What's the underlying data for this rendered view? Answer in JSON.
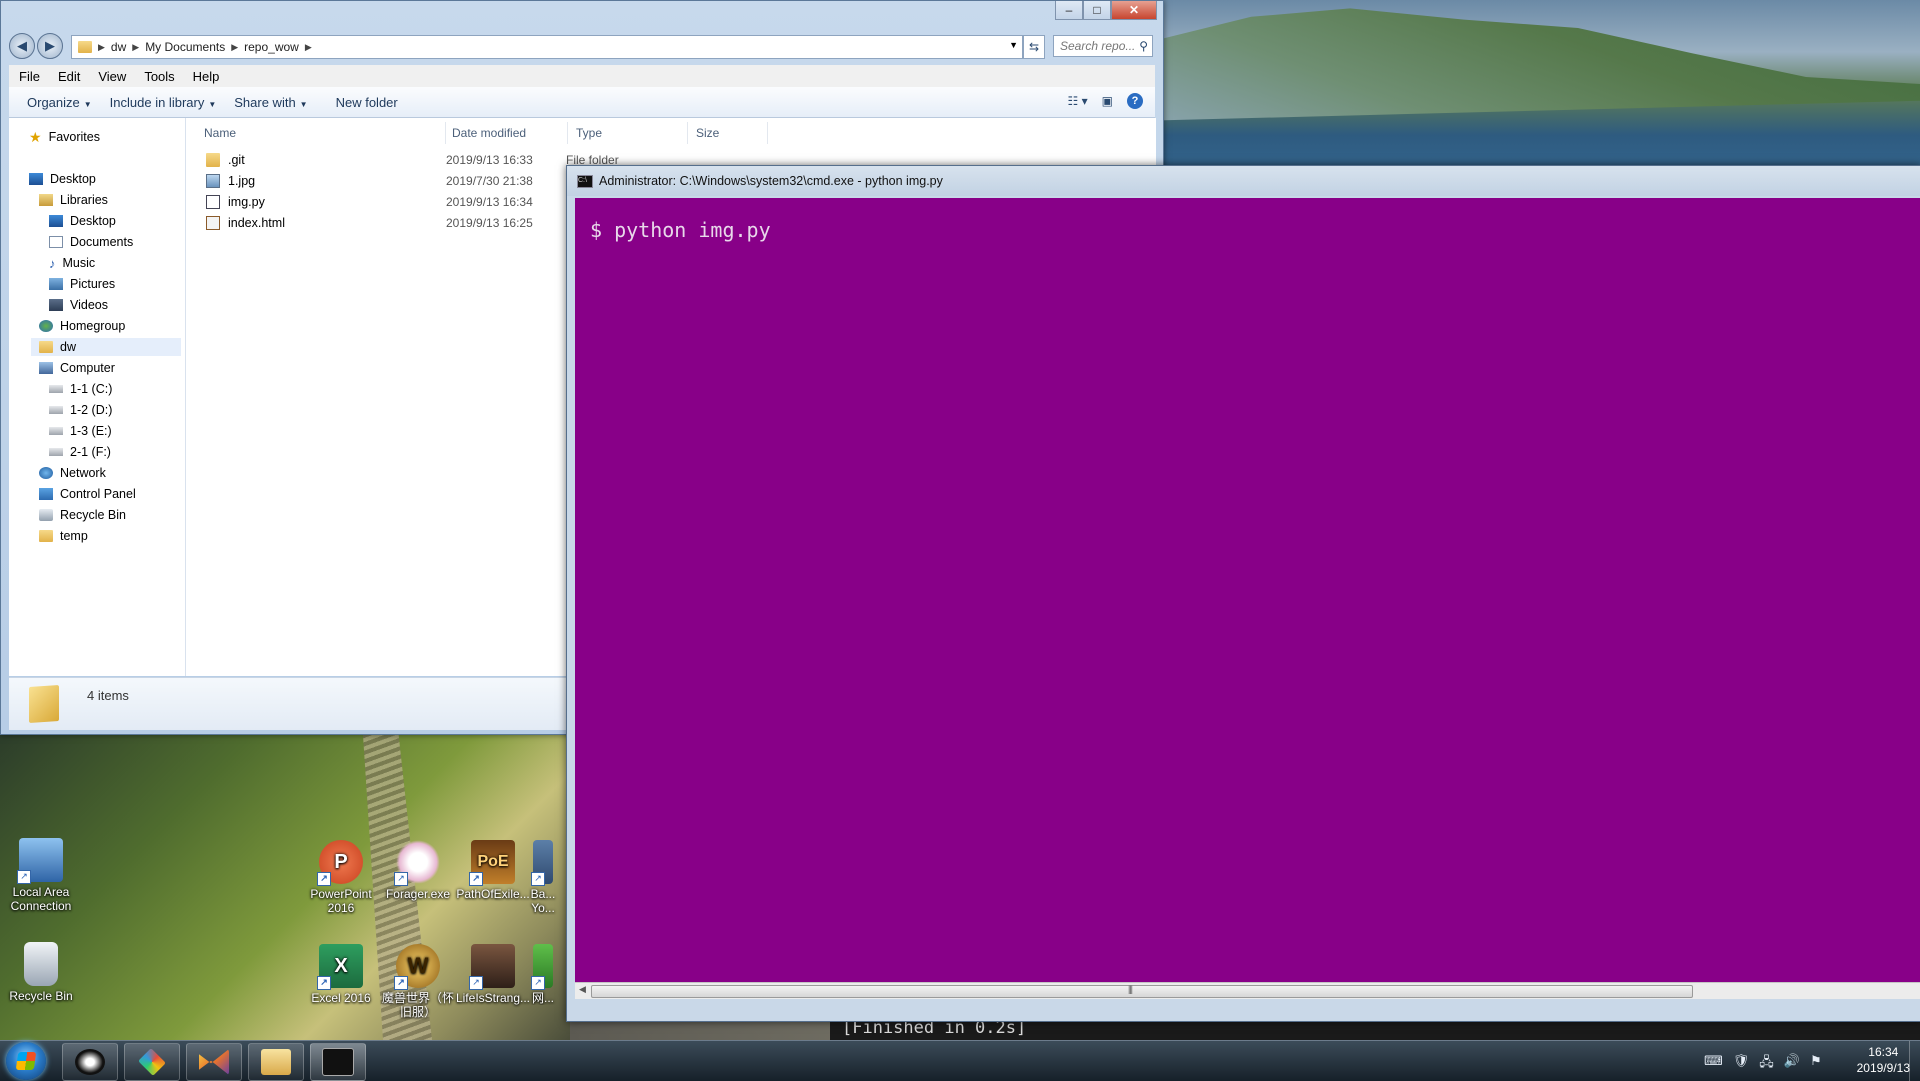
{
  "explorer": {
    "window_controls": {
      "minimize": "–",
      "maximize": "□",
      "close": "✕"
    },
    "breadcrumb": [
      "dw",
      "My Documents",
      "repo_wow"
    ],
    "search_placeholder": "Search repo...",
    "menu": [
      "File",
      "Edit",
      "View",
      "Tools",
      "Help"
    ],
    "commands": [
      "Organize",
      "Include in library",
      "Share with",
      "New folder"
    ],
    "columns": [
      "Name",
      "Date modified",
      "Type",
      "Size"
    ],
    "files": [
      {
        "name": ".git",
        "date": "2019/9/13 16:33",
        "type": "File folder",
        "icon": "folder-icon"
      },
      {
        "name": "1.jpg",
        "date": "2019/7/30 21:38",
        "type": "",
        "icon": "image-file-icon"
      },
      {
        "name": "img.py",
        "date": "2019/9/13 16:34",
        "type": "",
        "icon": "python-file-icon"
      },
      {
        "name": "index.html",
        "date": "2019/9/13 16:25",
        "type": "",
        "icon": "html-file-icon"
      }
    ],
    "nav": {
      "favorites": "Favorites",
      "desktop": "Desktop",
      "libraries": "Libraries",
      "lib_desktop": "Desktop",
      "documents": "Documents",
      "music": "Music",
      "pictures": "Pictures",
      "videos": "Videos",
      "homegroup": "Homegroup",
      "dw": "dw",
      "computer": "Computer",
      "drive_c": "1-1 (C:)",
      "drive_d": "1-2 (D:)",
      "drive_e": "1-3 (E:)",
      "drive_f": "2-1 (F:)",
      "network": "Network",
      "control_panel": "Control Panel",
      "recycle_bin": "Recycle Bin",
      "temp": "temp"
    },
    "status": "4 items"
  },
  "cmd": {
    "title": "Administrator: C:\\Windows\\system32\\cmd.exe - python  img.py",
    "output_line": "$ python img.py",
    "background_color": "#880088"
  },
  "behind_text": "[Finished in 0.2s]",
  "desktop_icons": [
    {
      "label": "Local Area\nConnection",
      "icon": "network-connection-icon"
    },
    {
      "label": "Recycle Bin",
      "icon": "recycle-bin-icon"
    },
    {
      "label": "PowerPoint\n2016",
      "icon": "powerpoint-icon"
    },
    {
      "label": "Forager.exe",
      "icon": "forager-icon"
    },
    {
      "label": "PathOfExile...",
      "icon": "path-of-exile-icon"
    },
    {
      "label": "Ba...\nYo...",
      "icon": "app-icon"
    },
    {
      "label": "Excel 2016",
      "icon": "excel-icon"
    },
    {
      "label": "魔兽世界（怀旧服）",
      "icon": "world-of-warcraft-icon"
    },
    {
      "label": "LifeIsStrang...",
      "icon": "life-is-strange-icon"
    },
    {
      "label": "网...",
      "icon": "app-icon"
    }
  ],
  "taskbar": {
    "clock_time": "16:34",
    "clock_date": "2019/9/13",
    "pinned": [
      "incognito-app-icon",
      "colorful-app-icon",
      "visual-studio-icon",
      "file-explorer-icon",
      "cmd-icon"
    ]
  }
}
